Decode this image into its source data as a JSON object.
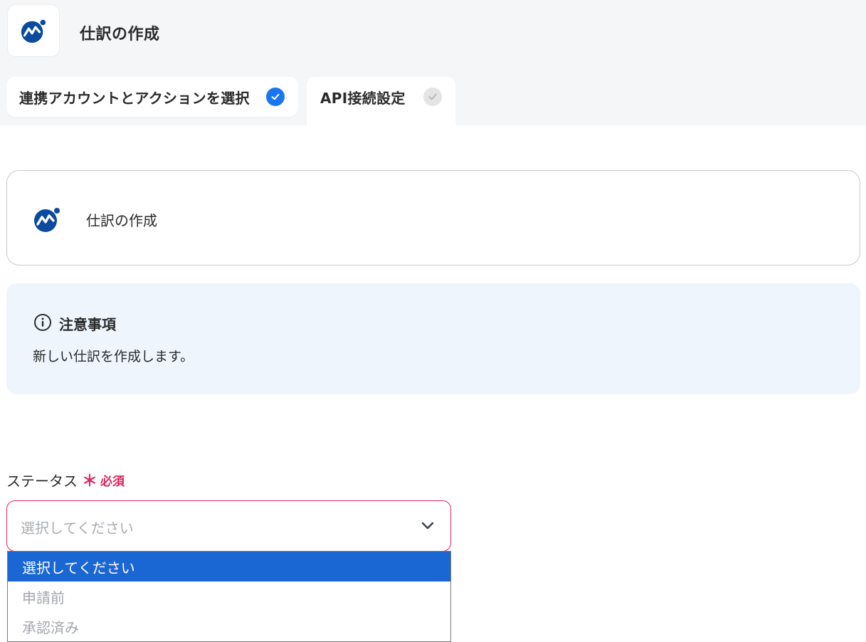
{
  "header": {
    "title": "仕訳の作成"
  },
  "tabs": [
    {
      "label": "連携アカウントとアクションを選択",
      "status": "complete"
    },
    {
      "label": "API接続設定",
      "status": "incomplete"
    }
  ],
  "action_card": {
    "label": "仕訳の作成"
  },
  "notice": {
    "title": "注意事項",
    "body": "新しい仕訳を作成します。"
  },
  "status_field": {
    "label": "ステータス",
    "required_mark": "＊",
    "required_text": "必須",
    "placeholder": "選択してください",
    "options": [
      "選択してください",
      "申請前",
      "承認済み"
    ],
    "highlighted_option": "選択してください"
  },
  "colors": {
    "accent": "#1976f0",
    "required": "#e0245e",
    "dropdown_highlight": "#1a66d2",
    "notice_bg": "#eef5fd",
    "brand": "#0b4a9e"
  }
}
